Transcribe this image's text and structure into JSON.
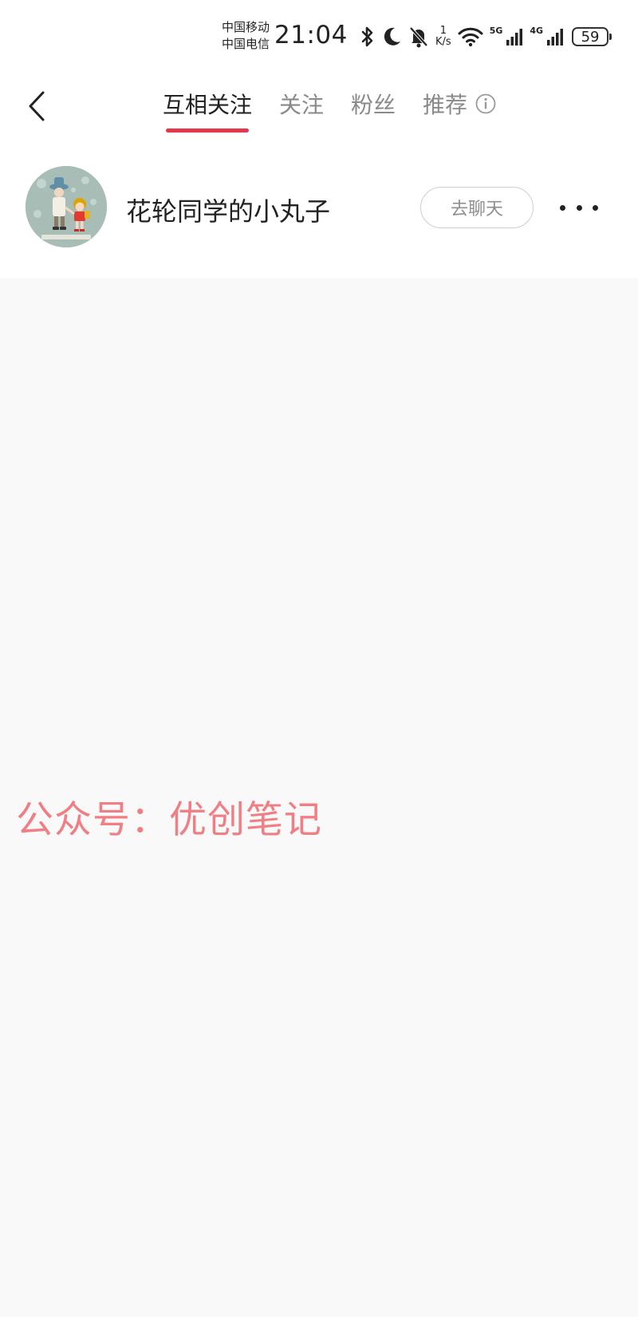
{
  "status_bar": {
    "carrier_1": "中国移动",
    "carrier_2": "中国电信",
    "time": "21:04",
    "net_speed_value": "1",
    "net_speed_unit": "K/s",
    "network_1": "5G",
    "network_2": "4G",
    "battery": "59",
    "icons": [
      "bluetooth-icon",
      "moon-icon",
      "bell-off-icon",
      "wifi-icon",
      "signal-icon",
      "battery-icon"
    ]
  },
  "header": {
    "tabs": [
      {
        "label": "互相关注",
        "active": true
      },
      {
        "label": "关注",
        "active": false
      },
      {
        "label": "粉丝",
        "active": false
      },
      {
        "label": "推荐",
        "active": false
      }
    ],
    "accent_color": "#e6364b"
  },
  "user": {
    "name": "花轮同学的小丸子",
    "chat_label": "去聊天"
  },
  "watermark": "公众号：优创笔记"
}
